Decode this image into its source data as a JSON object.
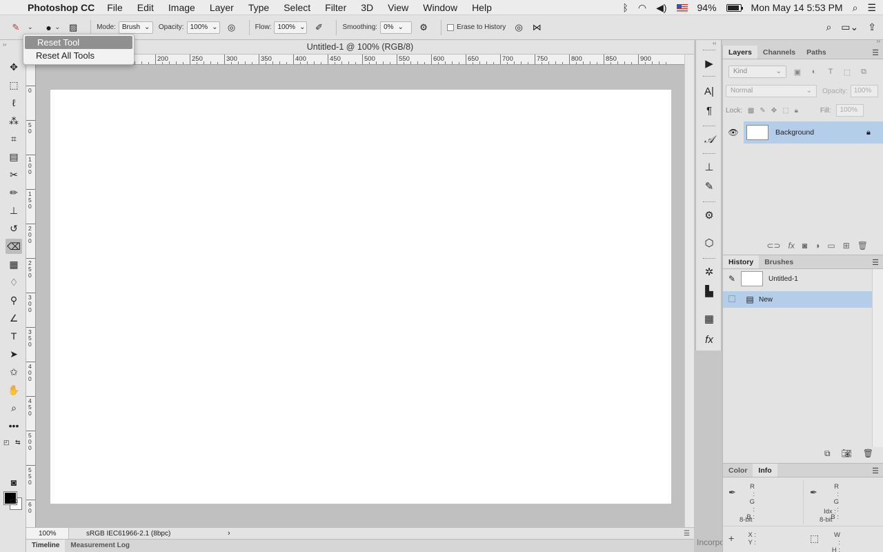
{
  "menubar": {
    "app_name": "Photoshop CC",
    "menus": [
      "File",
      "Edit",
      "Image",
      "Layer",
      "Type",
      "Select",
      "Filter",
      "3D",
      "View",
      "Window",
      "Help"
    ],
    "battery": "94%",
    "battery_level": 0.94,
    "datetime": "Mon May 14  5:53 PM"
  },
  "options": {
    "mode_label": "Mode:",
    "mode_value": "Brush",
    "opacity_label": "Opacity:",
    "opacity_value": "100%",
    "flow_label": "Flow:",
    "flow_value": "100%",
    "smoothing_label": "Smoothing:",
    "smoothing_value": "0%",
    "erase_history_label": "Erase to History"
  },
  "tool_menu": {
    "items": [
      "Reset Tool",
      "Reset All Tools"
    ]
  },
  "document": {
    "title": "Untitled-1 @ 100% (RGB/8)",
    "zoom": "100%",
    "profile": "sRGB IEC61966-2.1 (8bpc)",
    "ruler_labels": [
      "150",
      "200",
      "250",
      "300",
      "350",
      "400",
      "450",
      "500",
      "550",
      "600",
      "650",
      "700",
      "750",
      "800",
      "850",
      "900"
    ],
    "vruler_labels": [
      "0",
      "5 0",
      "1 0 0",
      "1 5 0",
      "2 0 0",
      "2 5 0",
      "3 0 0",
      "3 5 0",
      "4 0 0",
      "4 5 0",
      "5 0 0",
      "5 5 0",
      "6 0"
    ]
  },
  "bottom_tabs": [
    "Timeline",
    "Measurement Log"
  ],
  "incorp_text": "Incorpo",
  "layers_panel": {
    "tabs": [
      "Layers",
      "Channels",
      "Paths"
    ],
    "kind_label": "Kind",
    "blend_mode": "Normal",
    "opacity_label": "Opacity:",
    "opacity_value": "100%",
    "lock_label": "Lock:",
    "fill_label": "Fill:",
    "fill_value": "100%",
    "layers": [
      {
        "name": "Background"
      }
    ]
  },
  "history_panel": {
    "tabs": [
      "History",
      "Brushes"
    ],
    "snapshot": "Untitled-1",
    "states": [
      "New"
    ]
  },
  "info_panel": {
    "tabs": [
      "Color",
      "Info"
    ],
    "rgb_labels": [
      "R :",
      "G :",
      "B :"
    ],
    "bit_depth_left": "8-bit",
    "idx_label": "Idx :",
    "bit_depth_right": "8-bit",
    "xy_labels": [
      "X :",
      "Y :"
    ],
    "wh_labels": [
      "W :",
      "H :"
    ]
  }
}
